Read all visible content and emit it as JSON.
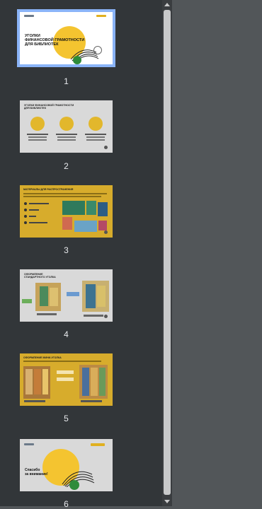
{
  "pages": [
    {
      "number": "1",
      "title_lines": [
        "УГОЛКИ",
        "ФИНАНСОВОЙ ГРАМОТНОСТИ",
        "ДЛЯ БИБЛИОТЕК"
      ]
    },
    {
      "number": "2",
      "title_lines": [
        "УГОЛКИ ФИНАНСОВОЙ ГРАМОТНОСТИ",
        "ДЛЯ БИБЛИОТЕК"
      ]
    },
    {
      "number": "3",
      "title_lines": [
        "МАТЕРИАЛЫ ДЛЯ РАСПРОСТРАНЕНИЯ"
      ]
    },
    {
      "number": "4",
      "title_lines": [
        "ОФОРМЛЕНИЕ",
        "СТАНДАРТНОГО УГОЛКА"
      ]
    },
    {
      "number": "5",
      "title_lines": [
        "ОФОРМЛЕНИЕ МИНИ-УГОЛКА"
      ]
    },
    {
      "number": "6",
      "title_lines": [
        "Спасибо",
        "за внимание!"
      ]
    }
  ],
  "colors": {
    "sidebar_bg": "#323639",
    "viewer_bg": "#525659",
    "selected_outline": "#8ab4f8",
    "brand_yellow": "#f4c430",
    "slide_ochre": "#d7ac2c"
  }
}
